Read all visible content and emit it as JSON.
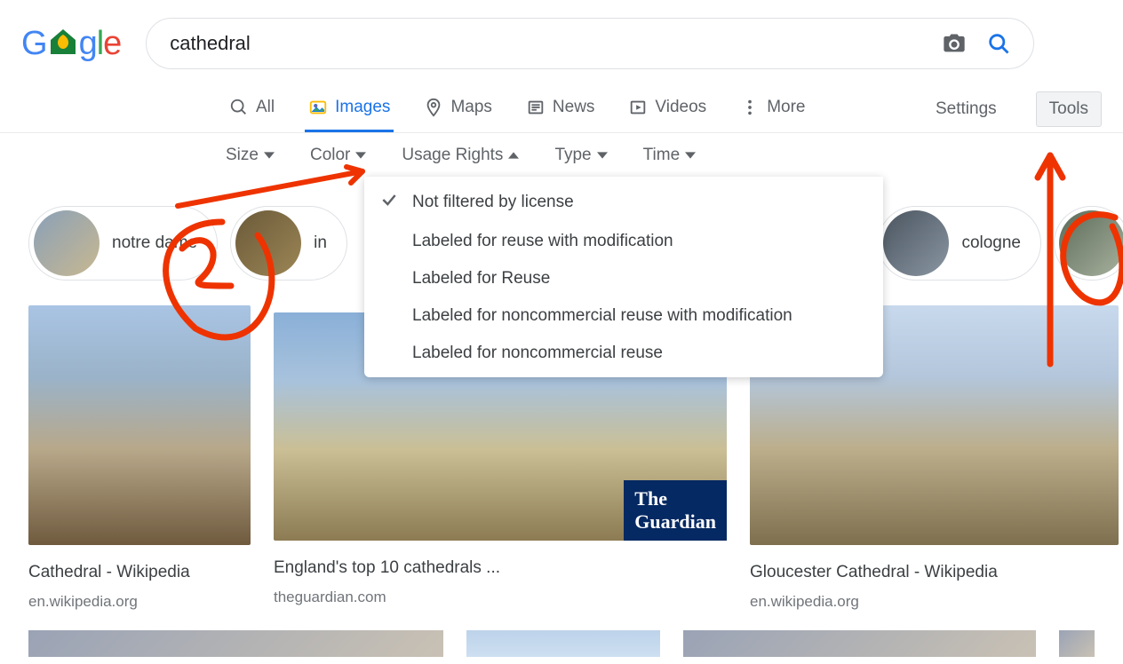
{
  "search": {
    "query": "cathedral"
  },
  "tabs": {
    "all": "All",
    "images": "Images",
    "maps": "Maps",
    "news": "News",
    "videos": "Videos",
    "more": "More",
    "settings": "Settings",
    "tools": "Tools"
  },
  "filters": {
    "size": "Size",
    "color": "Color",
    "usage_rights": "Usage Rights",
    "type": "Type",
    "time": "Time"
  },
  "usage_dropdown": {
    "o0": "Not filtered by license",
    "o1": "Labeled for reuse with modification",
    "o2": "Labeled for Reuse",
    "o3": "Labeled for noncommercial reuse with modification",
    "o4": "Labeled for noncommercial reuse"
  },
  "chips": {
    "c0": "notre dame",
    "c1": "in",
    "c2": "cologne"
  },
  "results": {
    "r0": {
      "title": "Cathedral - Wikipedia",
      "src": "en.wikipedia.org"
    },
    "r1": {
      "title": "England's top 10 cathedrals ...",
      "src": "theguardian.com"
    },
    "r2": {
      "title": "Gloucester Cathedral - Wikipedia",
      "src": "en.wikipedia.org"
    }
  },
  "badge": {
    "guardian_line1": "The",
    "guardian_line2": "Guardian"
  }
}
